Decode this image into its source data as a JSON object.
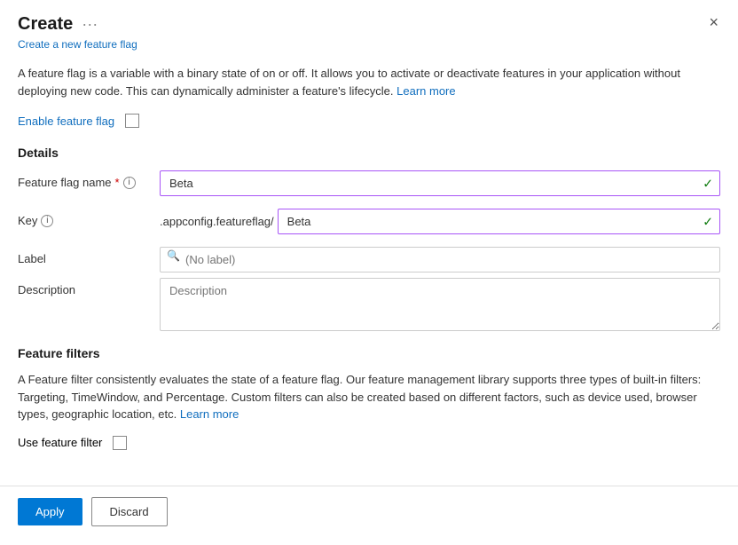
{
  "dialog": {
    "title": "Create",
    "subtitle": "Create a new feature flag",
    "ellipsis": "···",
    "close_label": "×"
  },
  "description": {
    "text1": "A feature flag is a variable with a binary state of on or off. It allows you to activate or deactivate features in your application without deploying new code. This can dynamically administer a feature's lifecycle.",
    "link_text": "Learn more",
    "link_href": "#"
  },
  "enable_flag": {
    "label": "Enable feature flag"
  },
  "details_section": {
    "title": "Details",
    "fields": {
      "flag_name": {
        "label": "Feature flag name",
        "required": "*",
        "value": "Beta",
        "has_check": true
      },
      "key": {
        "label": "Key",
        "prefix": ".appconfig.featureflag/",
        "value": "Beta",
        "has_check": true
      },
      "label_field": {
        "label": "Label",
        "placeholder": "(No label)"
      },
      "description_field": {
        "label": "Description",
        "placeholder": "Description"
      }
    }
  },
  "feature_filters_section": {
    "title": "Feature filters",
    "description": "A Feature filter consistently evaluates the state of a feature flag. Our feature management library supports three types of built-in filters: Targeting, TimeWindow, and Percentage. Custom filters can also be created based on different factors, such as device used, browser types, geographic location, etc.",
    "link_text": "Learn more",
    "link_href": "#",
    "use_filter_label": "Use feature filter"
  },
  "footer": {
    "apply_label": "Apply",
    "discard_label": "Discard"
  }
}
